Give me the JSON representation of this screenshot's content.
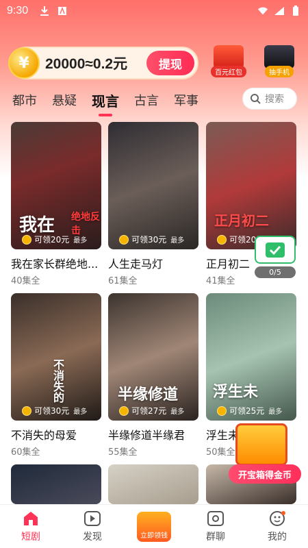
{
  "status_bar": {
    "time": "9:30"
  },
  "coins": {
    "amount_text": "20000≈0.2元",
    "coin_symbol": "¥",
    "withdraw_label": "提现"
  },
  "promos": [
    {
      "label": "百元红包",
      "color": "#e8312b"
    },
    {
      "label": "抽手机",
      "color": "#f5a200"
    }
  ],
  "tabs": [
    "都市",
    "悬疑",
    "现言",
    "古言",
    "军事"
  ],
  "active_tab": "现言",
  "search": {
    "placeholder": "搜索"
  },
  "cards": [
    {
      "title": "我在家长群绝地...",
      "episodes": "40集全",
      "reward": "可领20元",
      "more": "最多"
    },
    {
      "title": "人生走马灯",
      "episodes": "61集全",
      "reward": "可领30元",
      "more": "最多"
    },
    {
      "title": "正月初二",
      "episodes": "41集全",
      "reward": "可领20元",
      "more": "最多"
    },
    {
      "title": "不消失的母爱",
      "episodes": "60集全",
      "reward": "可领30元",
      "more": "最多"
    },
    {
      "title": "半缘修道半缘君",
      "episodes": "55集全",
      "reward": "可领27元",
      "more": "最多"
    },
    {
      "title": "浮生未歇",
      "episodes": "50集全",
      "reward": "可领25元",
      "more": "最多"
    }
  ],
  "poster_texts": {
    "p1": "我在",
    "p1b": "绝地反击",
    "p3": "正月初二",
    "p4": "不消失的",
    "p5": "半缘修道",
    "p6": "浮生未"
  },
  "float_check": {
    "progress": "0/5"
  },
  "treasure": {
    "label": "开宝箱得金币"
  },
  "nav": [
    {
      "label": "短剧",
      "icon": "home-icon",
      "active": true
    },
    {
      "label": "发现",
      "icon": "play-icon",
      "active": false
    },
    {
      "label": "立即领钱",
      "icon": "gift-icon",
      "active": false
    },
    {
      "label": "群聊",
      "icon": "chat-icon",
      "active": false
    },
    {
      "label": "我的",
      "icon": "profile-icon",
      "active": false
    }
  ]
}
